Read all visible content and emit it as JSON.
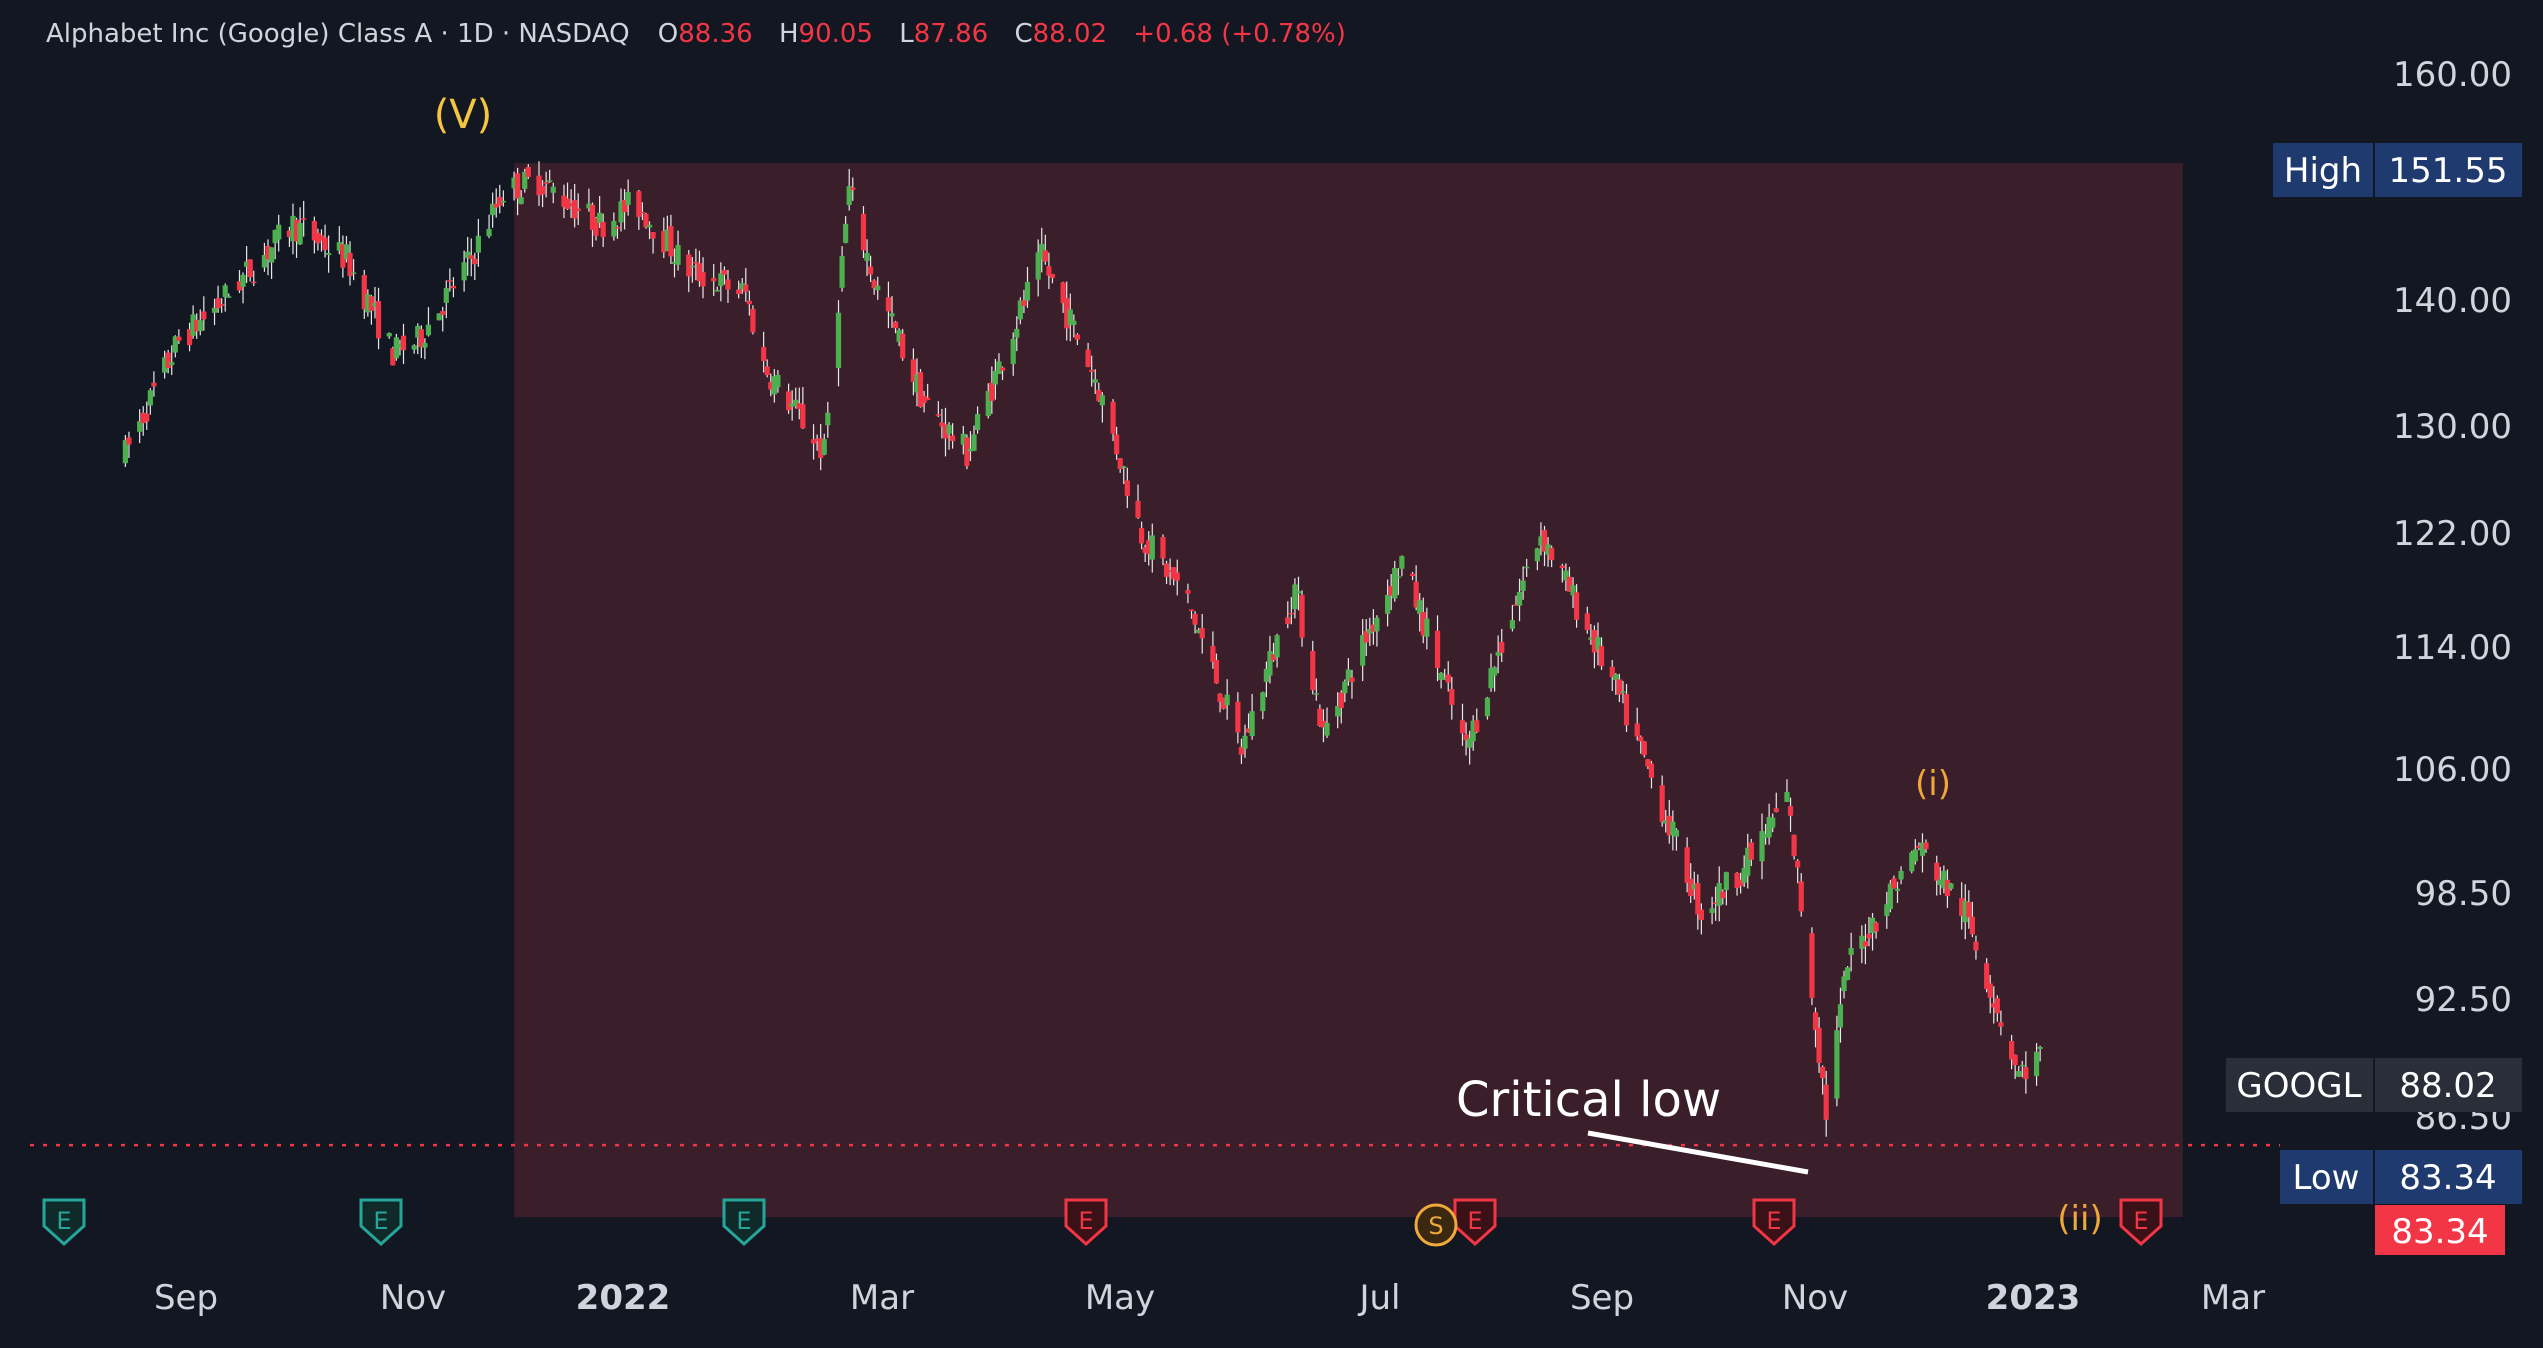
{
  "legend": {
    "symbol_desc": "Alphabet Inc (Google) Class A · 1D · NASDAQ",
    "open_label": "O",
    "open_value": "88.36",
    "high_label": "H",
    "high_value": "90.05",
    "low_label": "L",
    "low_value": "87.86",
    "close_label": "C",
    "close_value": "88.02",
    "change": "+0.68 (+0.78%)"
  },
  "colors": {
    "background": "#131722",
    "up": "#4caf50",
    "down": "#f23645",
    "highlight_zone": "#3a1f2b",
    "badge_blue": "#1e3a6e",
    "badge_grey": "#2a2e39",
    "badge_red": "#f23645",
    "wave": "#f5c542"
  },
  "price_axis": {
    "ticks": [
      "160.00",
      "140.00",
      "130.00",
      "122.00",
      "114.00",
      "106.00",
      "98.50",
      "92.50",
      "86.50"
    ],
    "high_badge": {
      "label": "High",
      "value": "151.55"
    },
    "symbol_badge": {
      "label": "GOOGL",
      "value": "88.02"
    },
    "low_badge": {
      "label": "Low",
      "value": "83.34"
    },
    "last_price_badge": "83.34"
  },
  "annotations": {
    "wave_V": "(V)",
    "wave_i": "(i)",
    "wave_ii": "(ii)",
    "critical_low": "Critical low"
  },
  "events": {
    "earnings_letter": "E",
    "split_letter": "S"
  },
  "chart_data": {
    "type": "candlestick",
    "title": "Alphabet Inc (Google) Class A · 1D · NASDAQ",
    "x_axis_labels": [
      "Sep",
      "Nov",
      "2022",
      "Mar",
      "May",
      "Jul",
      "Sep",
      "Nov",
      "2023",
      "Mar"
    ],
    "price_scale": "log",
    "ylim": [
      80,
      165
    ],
    "zone": {
      "high": 151.55,
      "low": 83.34,
      "from": "2021-11-01",
      "to": "2023-02-12"
    },
    "critical_low_level": 83.34,
    "anchors": [
      {
        "date": "2021-07-15",
        "price": 127
      },
      {
        "date": "2021-07-30",
        "price": 136
      },
      {
        "date": "2021-08-10",
        "price": 139
      },
      {
        "date": "2021-08-31",
        "price": 146
      },
      {
        "date": "2021-09-15",
        "price": 143
      },
      {
        "date": "2021-09-28",
        "price": 135
      },
      {
        "date": "2021-10-05",
        "price": 136
      },
      {
        "date": "2021-10-20",
        "price": 143
      },
      {
        "date": "2021-10-29",
        "price": 149
      },
      {
        "date": "2021-11-08",
        "price": 150
      },
      {
        "date": "2021-11-25",
        "price": 146
      },
      {
        "date": "2021-12-05",
        "price": 148
      },
      {
        "date": "2021-12-20",
        "price": 142
      },
      {
        "date": "2022-01-05",
        "price": 140
      },
      {
        "date": "2022-01-10",
        "price": 134
      },
      {
        "date": "2022-01-27",
        "price": 127
      },
      {
        "date": "2022-02-03",
        "price": 149
      },
      {
        "date": "2022-02-10",
        "price": 141
      },
      {
        "date": "2022-02-24",
        "price": 131
      },
      {
        "date": "2022-03-08",
        "price": 127
      },
      {
        "date": "2022-03-29",
        "price": 143
      },
      {
        "date": "2022-04-13",
        "price": 133
      },
      {
        "date": "2022-04-26",
        "price": 121
      },
      {
        "date": "2022-05-09",
        "price": 116
      },
      {
        "date": "2022-05-24",
        "price": 106
      },
      {
        "date": "2022-06-08",
        "price": 117
      },
      {
        "date": "2022-06-16",
        "price": 107
      },
      {
        "date": "2022-07-08",
        "price": 119
      },
      {
        "date": "2022-07-26",
        "price": 106
      },
      {
        "date": "2022-08-16",
        "price": 121
      },
      {
        "date": "2022-09-06",
        "price": 110
      },
      {
        "date": "2022-09-30",
        "price": 96
      },
      {
        "date": "2022-10-13",
        "price": 99
      },
      {
        "date": "2022-10-24",
        "price": 103
      },
      {
        "date": "2022-11-04",
        "price": 85
      },
      {
        "date": "2022-11-10",
        "price": 93
      },
      {
        "date": "2022-11-30",
        "price": 100
      },
      {
        "date": "2022-12-13",
        "price": 96
      },
      {
        "date": "2022-12-28",
        "price": 87
      },
      {
        "date": "2023-01-03",
        "price": 88
      }
    ]
  }
}
